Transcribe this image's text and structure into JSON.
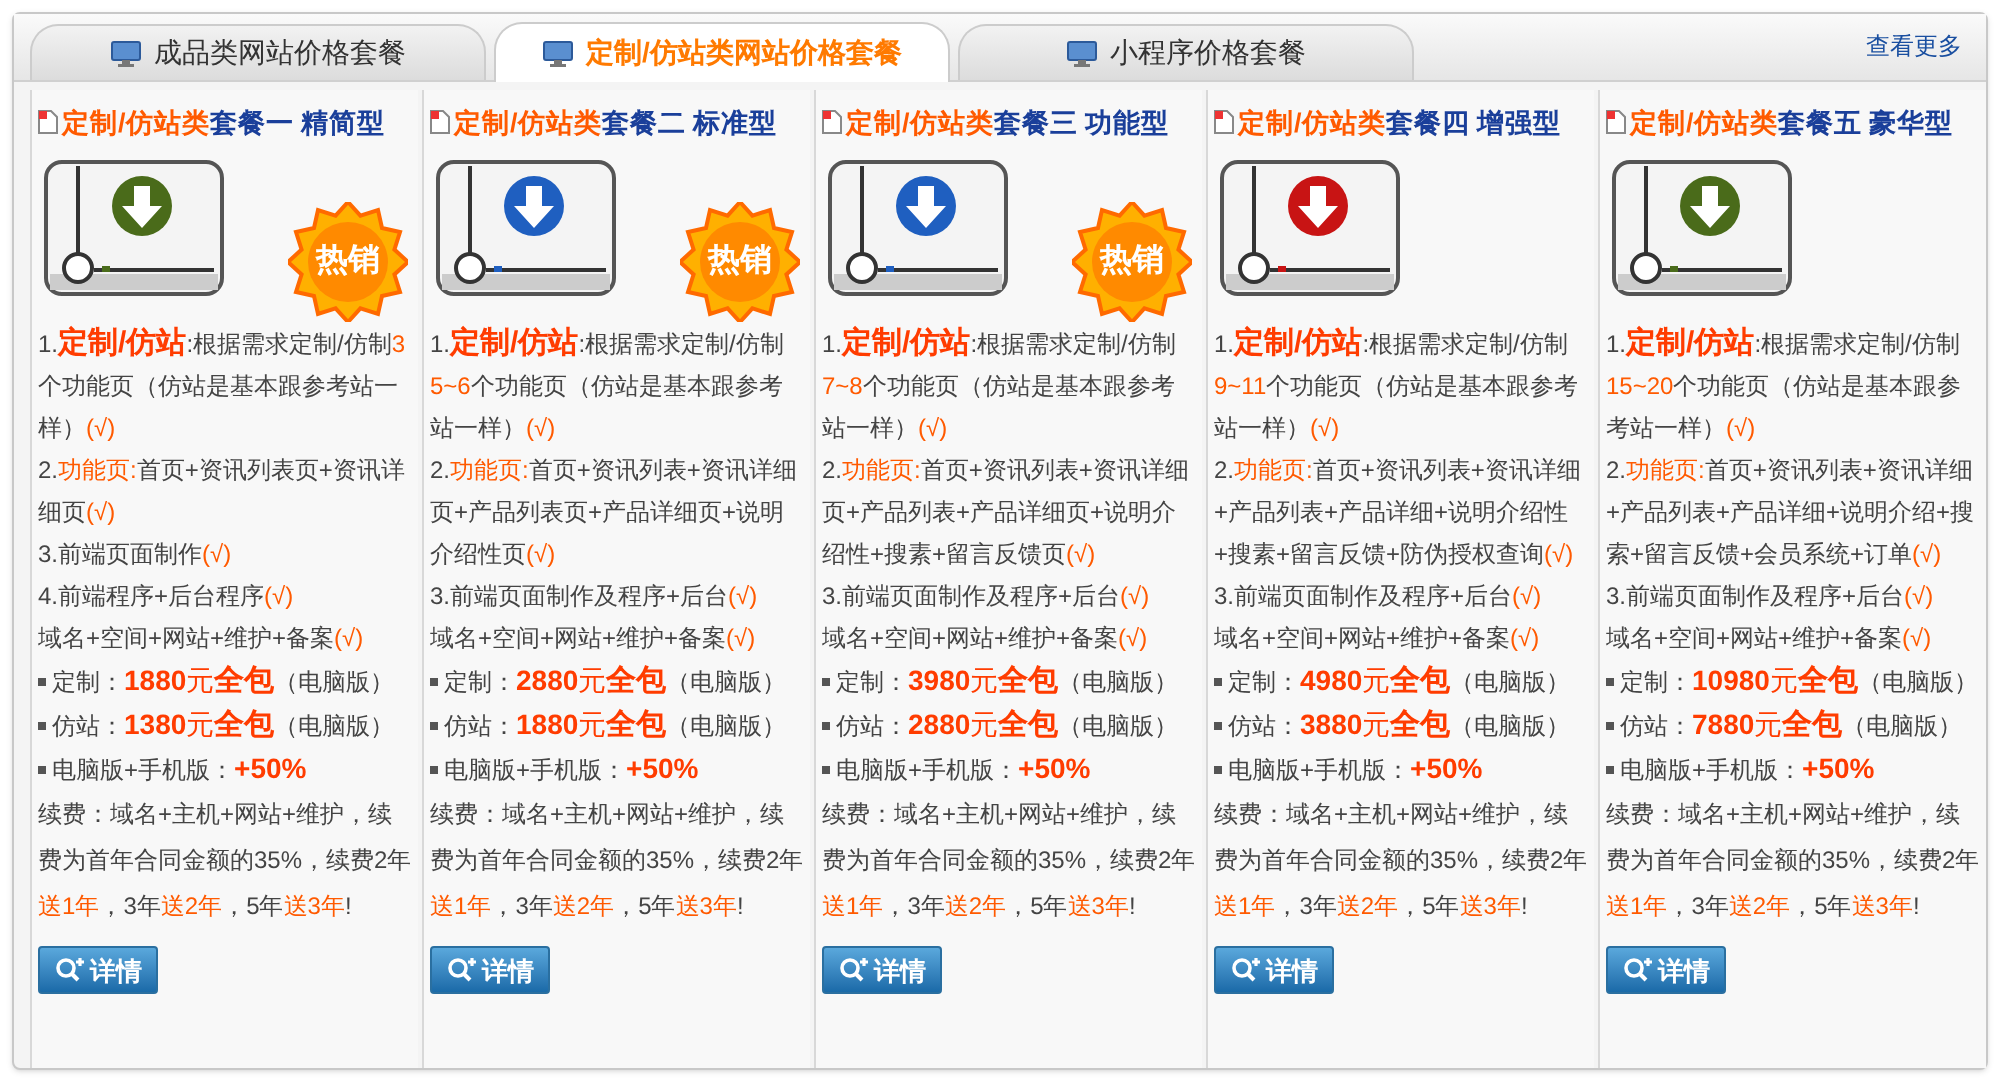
{
  "tabs": [
    {
      "label": "成品类网站价格套餐",
      "selected": false
    },
    {
      "label": "定制/仿站类网站价格套餐",
      "selected": true
    },
    {
      "label": "小程序价格套餐",
      "selected": false
    }
  ],
  "more_link": "查看更多",
  "packages": [
    {
      "title": [
        {
          "text": "定制/仿站类",
          "kind": "accent"
        },
        {
          "text": "套餐一 精简型",
          "kind": "plain"
        }
      ],
      "color": "#4a6b1a",
      "badge": "热销",
      "features": [
        [
          {
            "text": "1.",
            "kind": "plain"
          },
          {
            "text": "定制/仿站",
            "kind": "strong"
          },
          {
            "text": ":根据需求定制/仿制",
            "kind": "plain"
          },
          {
            "text": "3",
            "kind": "accent"
          },
          {
            "text": "个功能页（仿站是基本跟参考站一样）",
            "kind": "plain"
          },
          {
            "text": "(√)",
            "kind": "accent"
          }
        ],
        [
          {
            "text": "2.",
            "kind": "plain"
          },
          {
            "text": "功能页:",
            "kind": "accent"
          },
          {
            "text": "首页+资讯列表页+资讯详细页",
            "kind": "plain"
          },
          {
            "text": "(√)",
            "kind": "accent"
          }
        ],
        [
          {
            "text": "3.前端页面制作",
            "kind": "plain"
          },
          {
            "text": "(√)",
            "kind": "accent"
          }
        ],
        [
          {
            "text": "4.前端程序+后台程序",
            "kind": "plain"
          },
          {
            "text": "(√)",
            "kind": "accent"
          }
        ],
        [
          {
            "text": "域名+空间+网站+维护+备案",
            "kind": "plain"
          },
          {
            "text": "(√)",
            "kind": "accent"
          }
        ]
      ],
      "prices": [
        {
          "label": "定制：",
          "amount": "1880",
          "unit": "元",
          "tag": "全包",
          "note": "（电脑版）"
        },
        {
          "label": "仿站：",
          "amount": "1380",
          "unit": "元",
          "tag": "全包",
          "note": "（电脑版）"
        },
        {
          "label": "电脑版+手机版：",
          "amount": "+50%"
        }
      ],
      "renewal": [
        {
          "text": "续费：域名+主机+网站+维护，续费为首年合同金额的35%，续费2年",
          "kind": "plain"
        },
        {
          "text": "送1年",
          "kind": "accent"
        },
        {
          "text": "，3年",
          "kind": "plain"
        },
        {
          "text": "送2年",
          "kind": "accent"
        },
        {
          "text": "，5年",
          "kind": "plain"
        },
        {
          "text": "送3年",
          "kind": "accent"
        },
        {
          "text": "!",
          "kind": "plain"
        }
      ],
      "button": "详情"
    },
    {
      "title": [
        {
          "text": "定制/仿站类",
          "kind": "accent"
        },
        {
          "text": "套餐二 标准型",
          "kind": "plain"
        }
      ],
      "color": "#1f5fc0",
      "badge": "热销",
      "features": [
        [
          {
            "text": "1.",
            "kind": "plain"
          },
          {
            "text": "定制/仿站",
            "kind": "strong"
          },
          {
            "text": ":根据需求定制/仿制",
            "kind": "plain"
          },
          {
            "text": "5~6",
            "kind": "accent"
          },
          {
            "text": "个功能页（仿站是基本跟参考站一样）",
            "kind": "plain"
          },
          {
            "text": "(√)",
            "kind": "accent"
          }
        ],
        [
          {
            "text": "2.",
            "kind": "plain"
          },
          {
            "text": "功能页:",
            "kind": "accent"
          },
          {
            "text": "首页+资讯列表+资讯详细页+产品列表页+产品详细页+说明介绍性页",
            "kind": "plain"
          },
          {
            "text": "(√)",
            "kind": "accent"
          }
        ],
        [
          {
            "text": "3.前端页面制作及程序+后台",
            "kind": "plain"
          },
          {
            "text": "(√)",
            "kind": "accent"
          }
        ],
        [
          {
            "text": "域名+空间+网站+维护+备案",
            "kind": "plain"
          },
          {
            "text": "(√)",
            "kind": "accent"
          }
        ]
      ],
      "prices": [
        {
          "label": "定制：",
          "amount": "2880",
          "unit": "元",
          "tag": "全包",
          "note": "（电脑版）"
        },
        {
          "label": "仿站：",
          "amount": "1880",
          "unit": "元",
          "tag": "全包",
          "note": "（电脑版）"
        },
        {
          "label": "电脑版+手机版：",
          "amount": "+50%"
        }
      ],
      "renewal": [
        {
          "text": "续费：域名+主机+网站+维护，续费为首年合同金额的35%，续费2年",
          "kind": "plain"
        },
        {
          "text": "送1年",
          "kind": "accent"
        },
        {
          "text": "，3年",
          "kind": "plain"
        },
        {
          "text": "送2年",
          "kind": "accent"
        },
        {
          "text": "，5年",
          "kind": "plain"
        },
        {
          "text": "送3年",
          "kind": "accent"
        },
        {
          "text": "!",
          "kind": "plain"
        }
      ],
      "button": "详情"
    },
    {
      "title": [
        {
          "text": "定制/仿站类",
          "kind": "accent"
        },
        {
          "text": "套餐三 功能型",
          "kind": "plain"
        }
      ],
      "color": "#1f5fc0",
      "badge": "热销",
      "features": [
        [
          {
            "text": "1.",
            "kind": "plain"
          },
          {
            "text": "定制/仿站",
            "kind": "strong"
          },
          {
            "text": ":根据需求定制/仿制",
            "kind": "plain"
          },
          {
            "text": "7~8",
            "kind": "accent"
          },
          {
            "text": "个功能页（仿站是基本跟参考站一样）",
            "kind": "plain"
          },
          {
            "text": "(√)",
            "kind": "accent"
          }
        ],
        [
          {
            "text": "2.",
            "kind": "plain"
          },
          {
            "text": "功能页:",
            "kind": "accent"
          },
          {
            "text": "首页+资讯列表+资讯详细页+产品列表+产品详细页+说明介绍性+搜素+留言反馈页",
            "kind": "plain"
          },
          {
            "text": "(√)",
            "kind": "accent"
          }
        ],
        [
          {
            "text": "3.前端页面制作及程序+后台",
            "kind": "plain"
          },
          {
            "text": "(√)",
            "kind": "accent"
          }
        ],
        [
          {
            "text": "域名+空间+网站+维护+备案",
            "kind": "plain"
          },
          {
            "text": "(√)",
            "kind": "accent"
          }
        ]
      ],
      "prices": [
        {
          "label": "定制：",
          "amount": "3980",
          "unit": "元",
          "tag": "全包",
          "note": "（电脑版）"
        },
        {
          "label": "仿站：",
          "amount": "2880",
          "unit": "元",
          "tag": "全包",
          "note": "（电脑版）"
        },
        {
          "label": "电脑版+手机版：",
          "amount": "+50%"
        }
      ],
      "renewal": [
        {
          "text": "续费：域名+主机+网站+维护，续费为首年合同金额的35%，续费2年",
          "kind": "plain"
        },
        {
          "text": "送1年",
          "kind": "accent"
        },
        {
          "text": "，3年",
          "kind": "plain"
        },
        {
          "text": "送2年",
          "kind": "accent"
        },
        {
          "text": "，5年",
          "kind": "plain"
        },
        {
          "text": "送3年",
          "kind": "accent"
        },
        {
          "text": "!",
          "kind": "plain"
        }
      ],
      "button": "详情"
    },
    {
      "title": [
        {
          "text": "定制/仿站类",
          "kind": "accent"
        },
        {
          "text": "套餐四 增强型",
          "kind": "plain"
        }
      ],
      "color": "#c81414",
      "features": [
        [
          {
            "text": "1.",
            "kind": "plain"
          },
          {
            "text": "定制/仿站",
            "kind": "strong"
          },
          {
            "text": ":根据需求定制/仿制",
            "kind": "plain"
          },
          {
            "text": "9~11",
            "kind": "accent"
          },
          {
            "text": "个功能页（仿站是基本跟参考站一样）",
            "kind": "plain"
          },
          {
            "text": "(√)",
            "kind": "accent"
          }
        ],
        [
          {
            "text": "2.",
            "kind": "plain"
          },
          {
            "text": "功能页:",
            "kind": "accent"
          },
          {
            "text": "首页+资讯列表+资讯详细+产品列表+产品详细+说明介绍性+搜素+留言反馈+防伪授权查询",
            "kind": "plain"
          },
          {
            "text": "(√)",
            "kind": "accent"
          }
        ],
        [
          {
            "text": "3.前端页面制作及程序+后台",
            "kind": "plain"
          },
          {
            "text": "(√)",
            "kind": "accent"
          }
        ],
        [
          {
            "text": "域名+空间+网站+维护+备案",
            "kind": "plain"
          },
          {
            "text": "(√)",
            "kind": "accent"
          }
        ]
      ],
      "prices": [
        {
          "label": "定制：",
          "amount": "4980",
          "unit": "元",
          "tag": "全包",
          "note": "（电脑版）"
        },
        {
          "label": "仿站：",
          "amount": "3880",
          "unit": "元",
          "tag": "全包",
          "note": "（电脑版）"
        },
        {
          "label": "电脑版+手机版：",
          "amount": "+50%"
        }
      ],
      "renewal": [
        {
          "text": "续费：域名+主机+网站+维护，续费为首年合同金额的35%，续费2年",
          "kind": "plain"
        },
        {
          "text": "送1年",
          "kind": "accent"
        },
        {
          "text": "，3年",
          "kind": "plain"
        },
        {
          "text": "送2年",
          "kind": "accent"
        },
        {
          "text": "，5年",
          "kind": "plain"
        },
        {
          "text": "送3年",
          "kind": "accent"
        },
        {
          "text": "!",
          "kind": "plain"
        }
      ],
      "button": "详情"
    },
    {
      "title": [
        {
          "text": "定制/仿站类",
          "kind": "accent"
        },
        {
          "text": "套餐五 豪华型",
          "kind": "plain"
        }
      ],
      "color": "#4a6b1a",
      "features": [
        [
          {
            "text": "1.",
            "kind": "plain"
          },
          {
            "text": "定制/仿站",
            "kind": "strong"
          },
          {
            "text": ":根据需求定制/仿制",
            "kind": "plain"
          },
          {
            "text": "15~20",
            "kind": "accent"
          },
          {
            "text": "个功能页（仿站是基本跟参考站一样）",
            "kind": "plain"
          },
          {
            "text": "(√)",
            "kind": "accent"
          }
        ],
        [
          {
            "text": "2.",
            "kind": "plain"
          },
          {
            "text": "功能页:",
            "kind": "accent"
          },
          {
            "text": "首页+资讯列表+资讯详细+产品列表+产品详细+说明介绍+搜索+留言反馈+会员系统+订单",
            "kind": "plain"
          },
          {
            "text": "(√)",
            "kind": "accent"
          }
        ],
        [
          {
            "text": "3.前端页面制作及程序+后台",
            "kind": "plain"
          },
          {
            "text": "(√)",
            "kind": "accent"
          }
        ],
        [
          {
            "text": "域名+空间+网站+维护+备案",
            "kind": "plain"
          },
          {
            "text": "(√)",
            "kind": "accent"
          }
        ]
      ],
      "prices": [
        {
          "label": "定制：",
          "amount": "10980",
          "unit": "元",
          "tag": "全包",
          "note": "（电脑版）"
        },
        {
          "label": "仿站：",
          "amount": "7880",
          "unit": "元",
          "tag": "全包",
          "note": "（电脑版）"
        },
        {
          "label": "电脑版+手机版：",
          "amount": "+50%"
        }
      ],
      "renewal": [
        {
          "text": "续费：域名+主机+网站+维护，续费为首年合同金额的35%，续费2年",
          "kind": "plain"
        },
        {
          "text": "送1年",
          "kind": "accent"
        },
        {
          "text": "，3年",
          "kind": "plain"
        },
        {
          "text": "送2年",
          "kind": "accent"
        },
        {
          "text": "，5年",
          "kind": "plain"
        },
        {
          "text": "送3年",
          "kind": "accent"
        },
        {
          "text": "!",
          "kind": "plain"
        }
      ],
      "button": "详情"
    }
  ]
}
